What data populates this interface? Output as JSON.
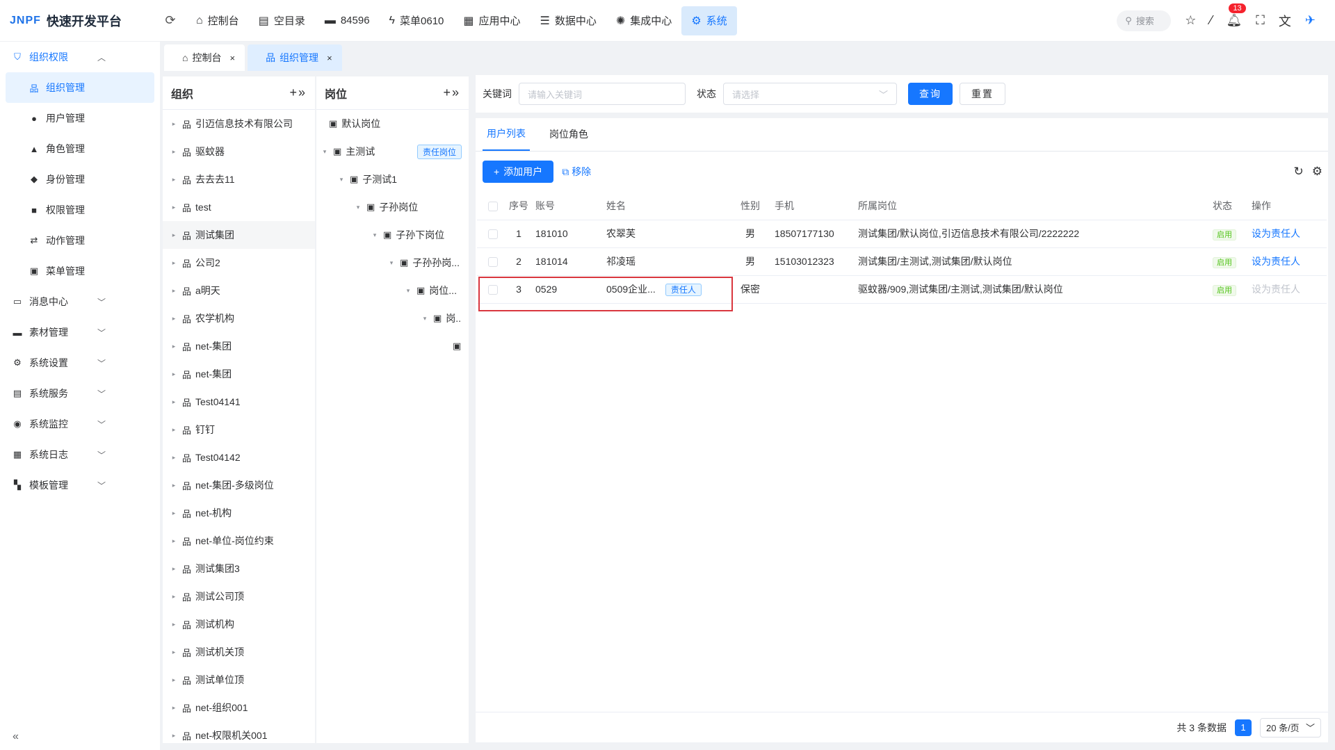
{
  "app": {
    "brand": "JNPF",
    "title": "快速开发平台"
  },
  "topnav": [
    {
      "label": "控制台",
      "icon": "home-icon"
    },
    {
      "label": "空目录",
      "icon": "folder-icon"
    },
    {
      "label": "84596",
      "icon": "folder-icon"
    },
    {
      "label": "菜单0610",
      "icon": "lightning-icon"
    },
    {
      "label": "应用中心",
      "icon": "grid-icon"
    },
    {
      "label": "数据中心",
      "icon": "database-icon"
    },
    {
      "label": "集成中心",
      "icon": "integration-icon"
    },
    {
      "label": "系统",
      "icon": "gear-icon",
      "active": true
    }
  ],
  "topright": {
    "search_placeholder": "搜索",
    "notifications": "13"
  },
  "sidebar": {
    "group": "组织权限",
    "items": [
      "组织管理",
      "用户管理",
      "角色管理",
      "身份管理",
      "权限管理",
      "动作管理",
      "菜单管理"
    ],
    "groups": [
      "消息中心",
      "素材管理",
      "系统设置",
      "系统服务",
      "系统监控",
      "系统日志",
      "模板管理"
    ]
  },
  "pagetabs": [
    {
      "label": "控制台"
    },
    {
      "label": "组织管理",
      "active": true
    }
  ],
  "org": {
    "title": "组织",
    "items": [
      "引迈信息技术有限公司",
      "驱蚊器",
      "去去去11",
      "test",
      "测试集团",
      "公司2",
      "a明天",
      "农学机构",
      "net-集团",
      "net-集团",
      "Test04141",
      "钉钉",
      "Test04142",
      "net-集团-多级岗位",
      "net-机构",
      "net-单位-岗位约束",
      "测试集团3",
      "测试公司顶",
      "测试机构",
      "测试机关顶",
      "测试单位顶",
      "net-组织001",
      "net-权限机关001"
    ]
  },
  "position": {
    "title": "岗位",
    "items": [
      "默认岗位",
      "主测试",
      "子测试1",
      "子孙岗位",
      "子孙下岗位",
      "子孙孙岗...",
      "岗位...",
      "岗..",
      ""
    ],
    "tag": "责任岗位"
  },
  "search": {
    "keyword_label": "关键词",
    "keyword_placeholder": "请输入关键词",
    "status_label": "状态",
    "status_placeholder": "请选择",
    "query": "查询",
    "reset": "重置"
  },
  "tabs": [
    "用户列表",
    "岗位角色"
  ],
  "toolbar": {
    "add": "添加用户",
    "remove": "移除"
  },
  "table": {
    "headers": [
      "序号",
      "账号",
      "姓名",
      "性别",
      "手机",
      "所属岗位",
      "状态",
      "操作"
    ],
    "rows": [
      {
        "no": "1",
        "account": "181010",
        "name": "农翠芙",
        "tag": "",
        "gender": "男",
        "phone": "18507177130",
        "post": "测试集团/默认岗位,引迈信息技术有限公司/2222222",
        "status": "启用",
        "action": "设为责任人"
      },
      {
        "no": "2",
        "account": "181014",
        "name": "祁凌瑶",
        "tag": "",
        "gender": "男",
        "phone": "15103012323",
        "post": "测试集团/主测试,测试集团/默认岗位",
        "status": "启用",
        "action": "设为责任人"
      },
      {
        "no": "3",
        "account": "0529",
        "name": "0509企业...",
        "tag": "责任人",
        "gender": "保密",
        "phone": "",
        "post": "驱蚊器/909,测试集团/主测试,测试集团/默认岗位",
        "status": "启用",
        "action": "设为责任人"
      }
    ]
  },
  "pager": {
    "total": "共 3 条数据",
    "page": "1",
    "size": "20 条/页"
  }
}
